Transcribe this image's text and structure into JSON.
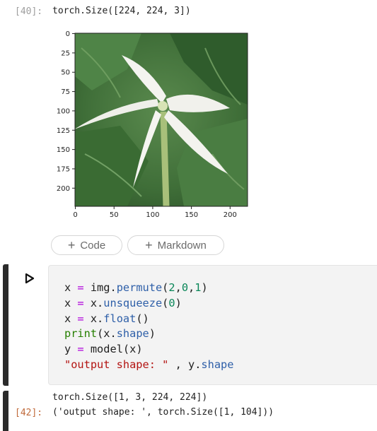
{
  "cell40": {
    "prompt": "[40]:",
    "output": "torch.Size([224, 224, 3])",
    "plot": {
      "y_ticks": [
        "0",
        "25",
        "50",
        "75",
        "100",
        "125",
        "150",
        "175",
        "200"
      ],
      "x_ticks": [
        "0",
        "50",
        "100",
        "150",
        "200"
      ],
      "image_description_icon": "white-star-flower-photo"
    }
  },
  "add_cell": {
    "code_label": "Code",
    "markdown_label": "Markdown",
    "plus_glyph": "+"
  },
  "code_cell": {
    "run_icon": "play-icon",
    "lines": [
      [
        {
          "t": "x ",
          "c": ""
        },
        {
          "t": "=",
          "c": "op"
        },
        {
          "t": " img.",
          "c": ""
        },
        {
          "t": "permute",
          "c": "fn"
        },
        {
          "t": "(",
          "c": ""
        },
        {
          "t": "2",
          "c": "num"
        },
        {
          "t": ",",
          "c": ""
        },
        {
          "t": "0",
          "c": "num"
        },
        {
          "t": ",",
          "c": ""
        },
        {
          "t": "1",
          "c": "num"
        },
        {
          "t": ")",
          "c": ""
        }
      ],
      [
        {
          "t": "x ",
          "c": ""
        },
        {
          "t": "=",
          "c": "op"
        },
        {
          "t": " x.",
          "c": ""
        },
        {
          "t": "unsqueeze",
          "c": "fn"
        },
        {
          "t": "(",
          "c": ""
        },
        {
          "t": "0",
          "c": "num"
        },
        {
          "t": ")",
          "c": ""
        }
      ],
      [
        {
          "t": "x ",
          "c": ""
        },
        {
          "t": "=",
          "c": "op"
        },
        {
          "t": " x.",
          "c": ""
        },
        {
          "t": "float",
          "c": "fn"
        },
        {
          "t": "()",
          "c": ""
        }
      ],
      [
        {
          "t": "print",
          "c": "builtin"
        },
        {
          "t": "(x.",
          "c": ""
        },
        {
          "t": "shape",
          "c": "fn"
        },
        {
          "t": ")",
          "c": ""
        }
      ],
      [
        {
          "t": "y ",
          "c": ""
        },
        {
          "t": "=",
          "c": "op"
        },
        {
          "t": " model(x)",
          "c": ""
        }
      ],
      [
        {
          "t": "\"output shape: \"",
          "c": "str"
        },
        {
          "t": " , y.",
          "c": ""
        },
        {
          "t": "shape",
          "c": "fn"
        }
      ]
    ]
  },
  "cell42": {
    "prompt": "[42]:",
    "line1": "torch.Size([1, 3, 224, 224])",
    "line2": "('output shape: ', torch.Size([1, 104]))"
  }
}
